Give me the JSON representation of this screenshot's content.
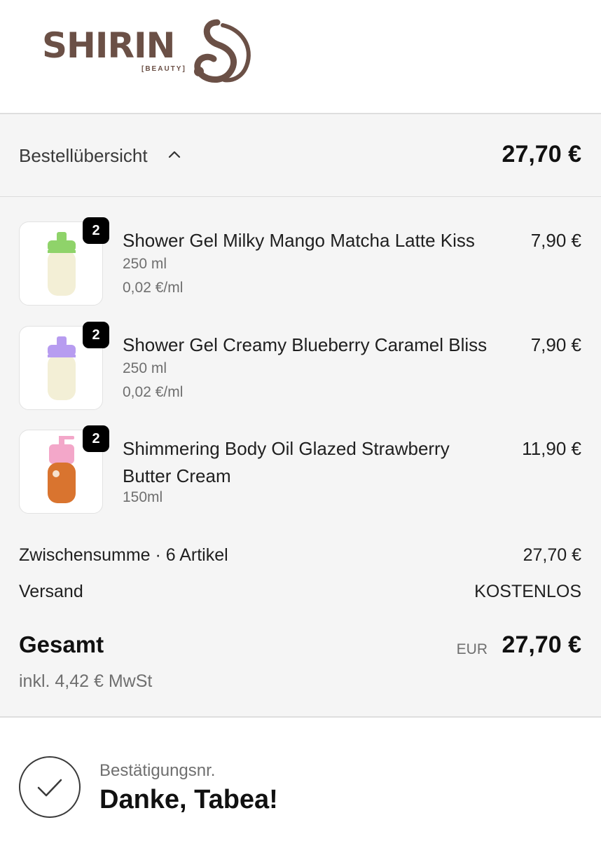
{
  "brand": {
    "name": "SHIRIN",
    "subtitle": "[BEAUTY]",
    "color": "#6b5046"
  },
  "summary": {
    "toggle_label": "Bestellübersicht",
    "toggle_total": "27,70 €",
    "items": [
      {
        "quantity": "2",
        "name": "Shower Gel Milky Mango Matcha Latte Kiss",
        "size": "250 ml",
        "unit_price": "0,02 €/ml",
        "price": "7,90 €",
        "cap_color": "#8fd36a",
        "body_color": "#f3efd6"
      },
      {
        "quantity": "2",
        "name": "Shower Gel Creamy Blueberry Caramel Bliss",
        "size": "250 ml",
        "unit_price": "0,02 €/ml",
        "price": "7,90 €",
        "cap_color": "#b79cf0",
        "body_color": "#f3efd6"
      },
      {
        "quantity": "2",
        "name": "Shimmering Body Oil Glazed Strawberry Butter Cream",
        "size": "150ml",
        "price": "11,90 €",
        "cap_color": "#f3a7c9",
        "body_color": "#d9742f"
      }
    ],
    "subtotal_label": "Zwischensumme · 6 Artikel",
    "subtotal_value": "27,70 €",
    "shipping_label": "Versand",
    "shipping_value": "KOSTENLOS",
    "total_label": "Gesamt",
    "total_currency": "EUR",
    "total_value": "27,70 €",
    "tax_note": "inkl. 4,42 € MwSt"
  },
  "confirmation": {
    "label": "Bestätigungsnr.",
    "thanks": "Danke, Tabea!",
    "icon": "check-circle-icon"
  }
}
